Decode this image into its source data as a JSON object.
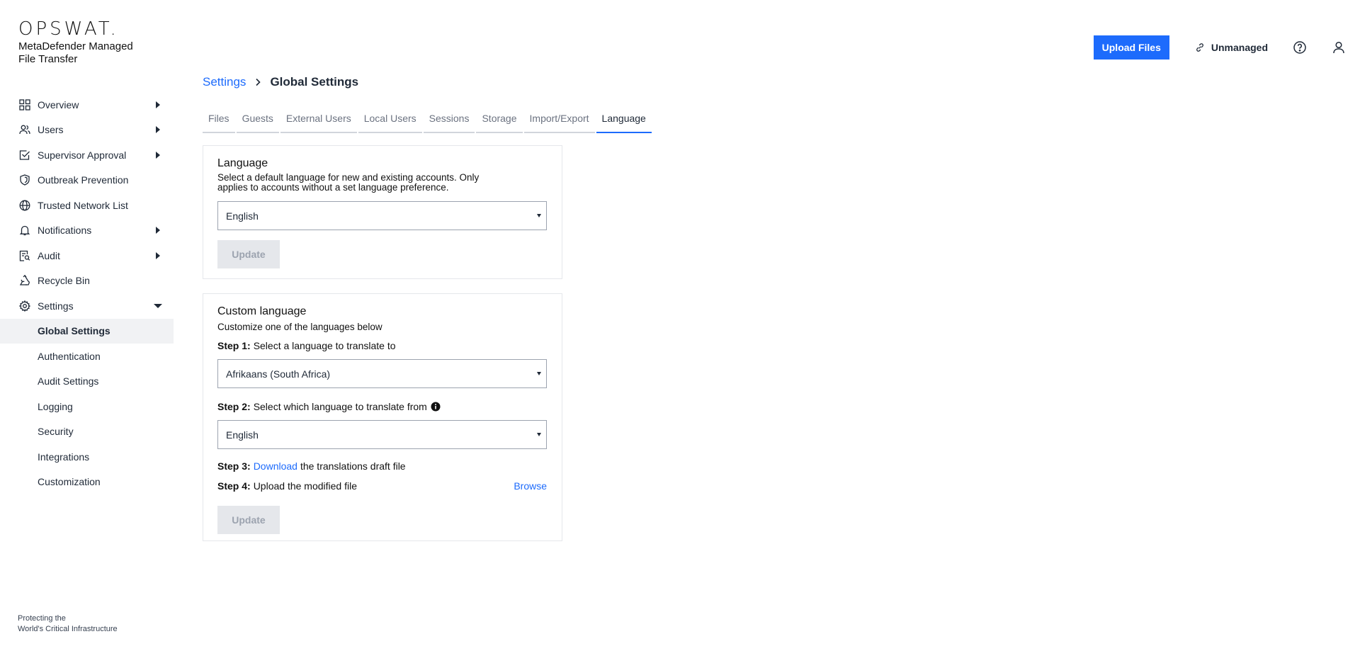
{
  "brand": {
    "logo": "OPSWAT.",
    "product": "MetaDefender Managed File Transfer"
  },
  "topbar": {
    "upload_label": "Upload Files",
    "unmanaged_label": "Unmanaged",
    "help_icon": "help-circle-icon",
    "user_icon": "user-icon"
  },
  "sidebar": {
    "items": [
      {
        "label": "Overview",
        "icon": "grid-icon",
        "expandable": true
      },
      {
        "label": "Users",
        "icon": "users-icon",
        "expandable": true
      },
      {
        "label": "Supervisor Approval",
        "icon": "checkbox-icon",
        "expandable": true
      },
      {
        "label": "Outbreak Prevention",
        "icon": "shield-icon",
        "expandable": false
      },
      {
        "label": "Trusted Network List",
        "icon": "globe-icon",
        "expandable": false
      },
      {
        "label": "Notifications",
        "icon": "bell-icon",
        "expandable": true
      },
      {
        "label": "Audit",
        "icon": "audit-icon",
        "expandable": true
      },
      {
        "label": "Recycle Bin",
        "icon": "recycle-icon",
        "expandable": false
      },
      {
        "label": "Settings",
        "icon": "gear-icon",
        "expandable": true,
        "expanded": true
      }
    ],
    "settings_children": [
      {
        "label": "Global Settings",
        "active": true
      },
      {
        "label": "Authentication"
      },
      {
        "label": "Audit Settings"
      },
      {
        "label": "Logging"
      },
      {
        "label": "Security"
      },
      {
        "label": "Integrations"
      },
      {
        "label": "Customization"
      }
    ],
    "footer_line1": "Protecting the",
    "footer_line2": "World's Critical Infrastructure"
  },
  "breadcrumb": {
    "parent": "Settings",
    "current": "Global Settings"
  },
  "tabs": [
    {
      "label": "Files"
    },
    {
      "label": "Guests"
    },
    {
      "label": "External Users"
    },
    {
      "label": "Local Users"
    },
    {
      "label": "Sessions"
    },
    {
      "label": "Storage"
    },
    {
      "label": "Import/Export"
    },
    {
      "label": "Language",
      "active": true
    }
  ],
  "language_card": {
    "title": "Language",
    "description": "Select a default language for new and existing accounts. Only applies to accounts without a set language preference.",
    "selected": "English",
    "update_label": "Update"
  },
  "custom_card": {
    "title": "Custom language",
    "description": "Customize one of the languages below",
    "step1_prefix": "Step 1:",
    "step1_text": "Select a language to translate to",
    "step1_selected": "Afrikaans (South Africa)",
    "step2_prefix": "Step 2:",
    "step2_text": "Select which language to translate from",
    "step2_selected": "English",
    "step3_prefix": "Step 3:",
    "step3_link": "Download",
    "step3_text": "the translations draft file",
    "step4_prefix": "Step 4:",
    "step4_text": "Upload the modified file",
    "browse_label": "Browse",
    "update_label": "Update"
  },
  "colors": {
    "accent": "#1d6bfc",
    "text": "#1f2937",
    "muted": "#6b7280",
    "disabled_bg": "#e5e7eb",
    "active_bg": "#f1f2f4"
  }
}
